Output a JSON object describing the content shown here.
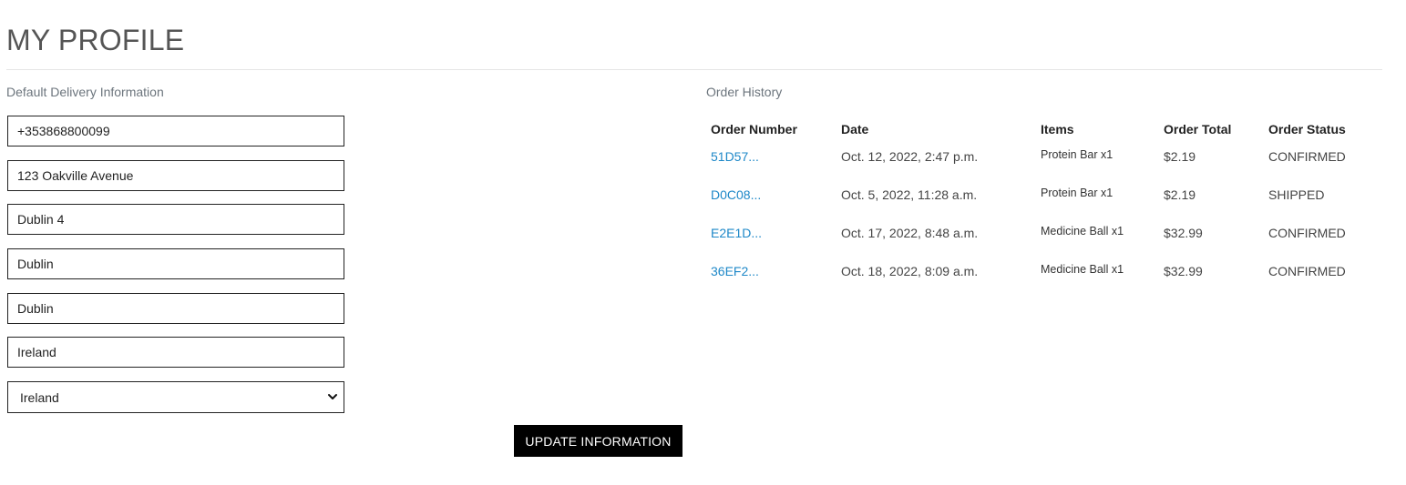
{
  "page": {
    "title": "MY PROFILE"
  },
  "delivery": {
    "section_label": "Default Delivery Information",
    "phone": "+353868800099",
    "street_address": "123 Oakville Avenue",
    "town_or_city": "Dublin 4",
    "county": "Dublin",
    "postcode": "Dublin",
    "country_text": "Ireland",
    "country_select": "Ireland",
    "update_button": "UPDATE INFORMATION"
  },
  "orders": {
    "section_label": "Order History",
    "headers": [
      "Order Number",
      "Date",
      "Items",
      "Order Total",
      "Order Status"
    ],
    "rows": [
      {
        "number": "51D57...",
        "date": "Oct. 12, 2022, 2:47 p.m.",
        "items": "Protein Bar x1",
        "total": "$2.19",
        "status": "CONFIRMED"
      },
      {
        "number": "D0C08...",
        "date": "Oct. 5, 2022, 11:28 a.m.",
        "items": "Protein Bar x1",
        "total": "$2.19",
        "status": "SHIPPED"
      },
      {
        "number": "E2E1D...",
        "date": "Oct. 17, 2022, 8:48 a.m.",
        "items": "Medicine Ball x1",
        "total": "$32.99",
        "status": "CONFIRMED"
      },
      {
        "number": "36EF2...",
        "date": "Oct. 18, 2022, 8:09 a.m.",
        "items": "Medicine Ball x1",
        "total": "$32.99",
        "status": "CONFIRMED"
      }
    ]
  },
  "icons": {
    "select_chevron": "chevron-down-icon"
  },
  "colors": {
    "link": "#1e88c8",
    "button_bg": "#000000",
    "button_text": "#ffffff",
    "muted_label": "#6c757d"
  }
}
